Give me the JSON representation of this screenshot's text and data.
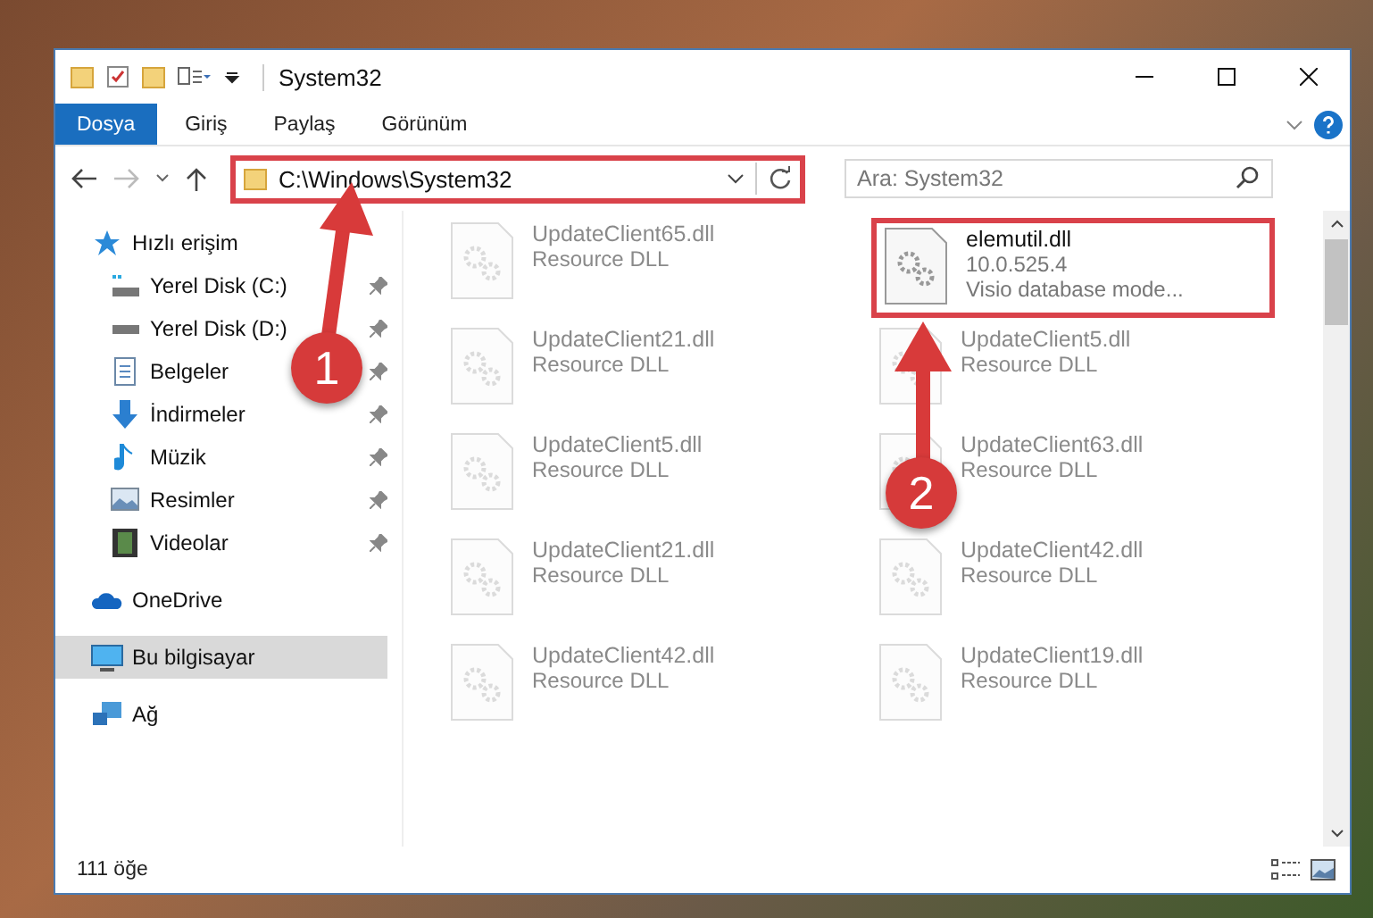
{
  "window": {
    "title": "System32"
  },
  "ribbon_tabs": [
    {
      "label": "Dosya",
      "selected": true
    },
    {
      "label": "Giriş",
      "selected": false
    },
    {
      "label": "Paylaş",
      "selected": false
    },
    {
      "label": "Görünüm",
      "selected": false
    }
  ],
  "address": {
    "path": "C:\\Windows\\System32",
    "highlighted": true
  },
  "search": {
    "placeholder": "Ara: System32"
  },
  "sidebar": {
    "items": [
      {
        "label": "Hızlı erişim",
        "pinned": false,
        "selected": false,
        "children": [
          {
            "label": "Yerel Disk (C:)",
            "pinned": true,
            "selected": false
          },
          {
            "label": "Yerel Disk (D:)",
            "pinned": true,
            "selected": false
          },
          {
            "label": "Belgeler",
            "pinned": true,
            "selected": false
          },
          {
            "label": "İndirmeler",
            "pinned": true,
            "selected": false
          },
          {
            "label": "Müzik",
            "pinned": true,
            "selected": false
          },
          {
            "label": "Resimler",
            "pinned": true,
            "selected": false
          },
          {
            "label": "Videolar",
            "pinned": true,
            "selected": false
          }
        ]
      },
      {
        "label": "OneDrive",
        "pinned": false,
        "selected": false
      },
      {
        "label": "Bu bilgisayar",
        "pinned": false,
        "selected": true
      },
      {
        "label": "Ağ",
        "pinned": false,
        "selected": false
      }
    ]
  },
  "files": [
    {
      "name": "UpdateClient65.dll",
      "type": "Resource DLL",
      "faded": true,
      "highlighted": false
    },
    {
      "name": "elemutil.dll",
      "version": "10.0.525.4",
      "type": "Visio database mode...",
      "faded": false,
      "highlighted": true
    },
    {
      "name": "UpdateClient21.dll",
      "type": "Resource DLL",
      "faded": true,
      "highlighted": false
    },
    {
      "name": "UpdateClient5.dll",
      "type": "Resource DLL",
      "faded": true,
      "highlighted": false
    },
    {
      "name": "UpdateClient5.dll",
      "type": "Resource DLL",
      "faded": true,
      "highlighted": false
    },
    {
      "name": "UpdateClient63.dll",
      "type": "Resource DLL",
      "faded": true,
      "highlighted": false
    },
    {
      "name": "UpdateClient21.dll",
      "type": "Resource DLL",
      "faded": true,
      "highlighted": false
    },
    {
      "name": "UpdateClient42.dll",
      "type": "Resource DLL",
      "faded": true,
      "highlighted": false
    },
    {
      "name": "UpdateClient42.dll",
      "type": "Resource DLL",
      "faded": true,
      "highlighted": false
    },
    {
      "name": "UpdateClient19.dll",
      "type": "Resource DLL",
      "faded": true,
      "highlighted": false
    }
  ],
  "annotations": [
    {
      "label": "1"
    },
    {
      "label": "2"
    }
  ],
  "status_bar": {
    "count": "111 öğe"
  }
}
